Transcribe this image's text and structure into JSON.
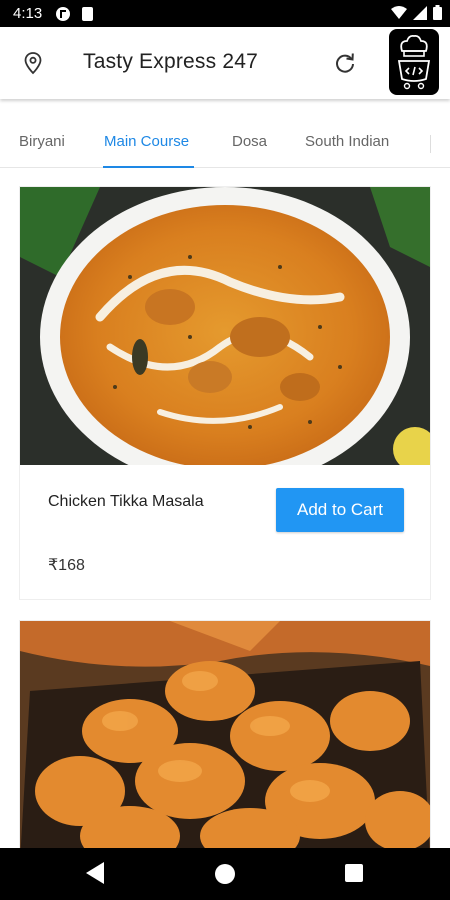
{
  "status_bar": {
    "time": "4:13"
  },
  "header": {
    "title": "Tasty Express 247"
  },
  "tabs": [
    {
      "label": "Biryani"
    },
    {
      "label": "Main Course",
      "active": true
    },
    {
      "label": "Dosa"
    },
    {
      "label": "South Indian"
    }
  ],
  "items": [
    {
      "name": "Chicken Tikka Masala",
      "price": "₹168",
      "button": "Add to Cart"
    },
    {
      "name": "",
      "price": "",
      "button": ""
    }
  ],
  "colors": {
    "accent": "#1e88e5",
    "button": "#2196f3",
    "status_bar": "#000000"
  },
  "icons": [
    "location-icon",
    "refresh-icon",
    "chef-logo-icon",
    "back-icon",
    "home-icon",
    "recents-icon",
    "wifi-icon",
    "signal-icon",
    "battery-icon"
  ]
}
